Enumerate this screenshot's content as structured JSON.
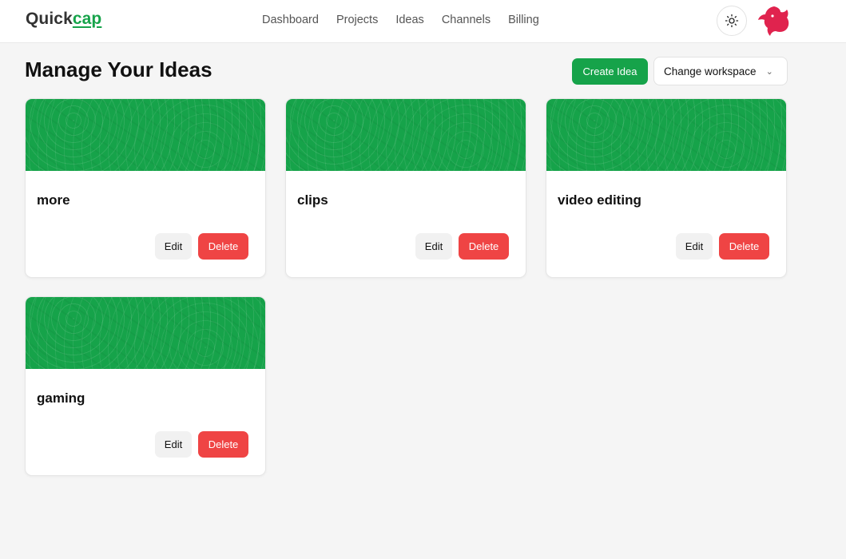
{
  "brand": {
    "prefix": "Quick",
    "accent": "cap"
  },
  "nav": {
    "items": [
      "Dashboard",
      "Projects",
      "Ideas",
      "Channels",
      "Billing"
    ]
  },
  "header": {
    "title": "Manage Your Ideas",
    "create_label": "Create Idea",
    "workspace_label": "Change workspace"
  },
  "ideas": [
    {
      "name": "more",
      "edit_label": "Edit",
      "delete_label": "Delete"
    },
    {
      "name": "clips",
      "edit_label": "Edit",
      "delete_label": "Delete"
    },
    {
      "name": "video editing",
      "edit_label": "Edit",
      "delete_label": "Delete"
    },
    {
      "name": "gaming",
      "edit_label": "Edit",
      "delete_label": "Delete"
    }
  ],
  "colors": {
    "accent": "#16a34a",
    "danger": "#ef4444",
    "logo": "#e0234e"
  },
  "icons": {
    "theme": "sun-icon",
    "logo": "nestjs-logo-icon",
    "dropdown": "chevron-down-icon"
  }
}
